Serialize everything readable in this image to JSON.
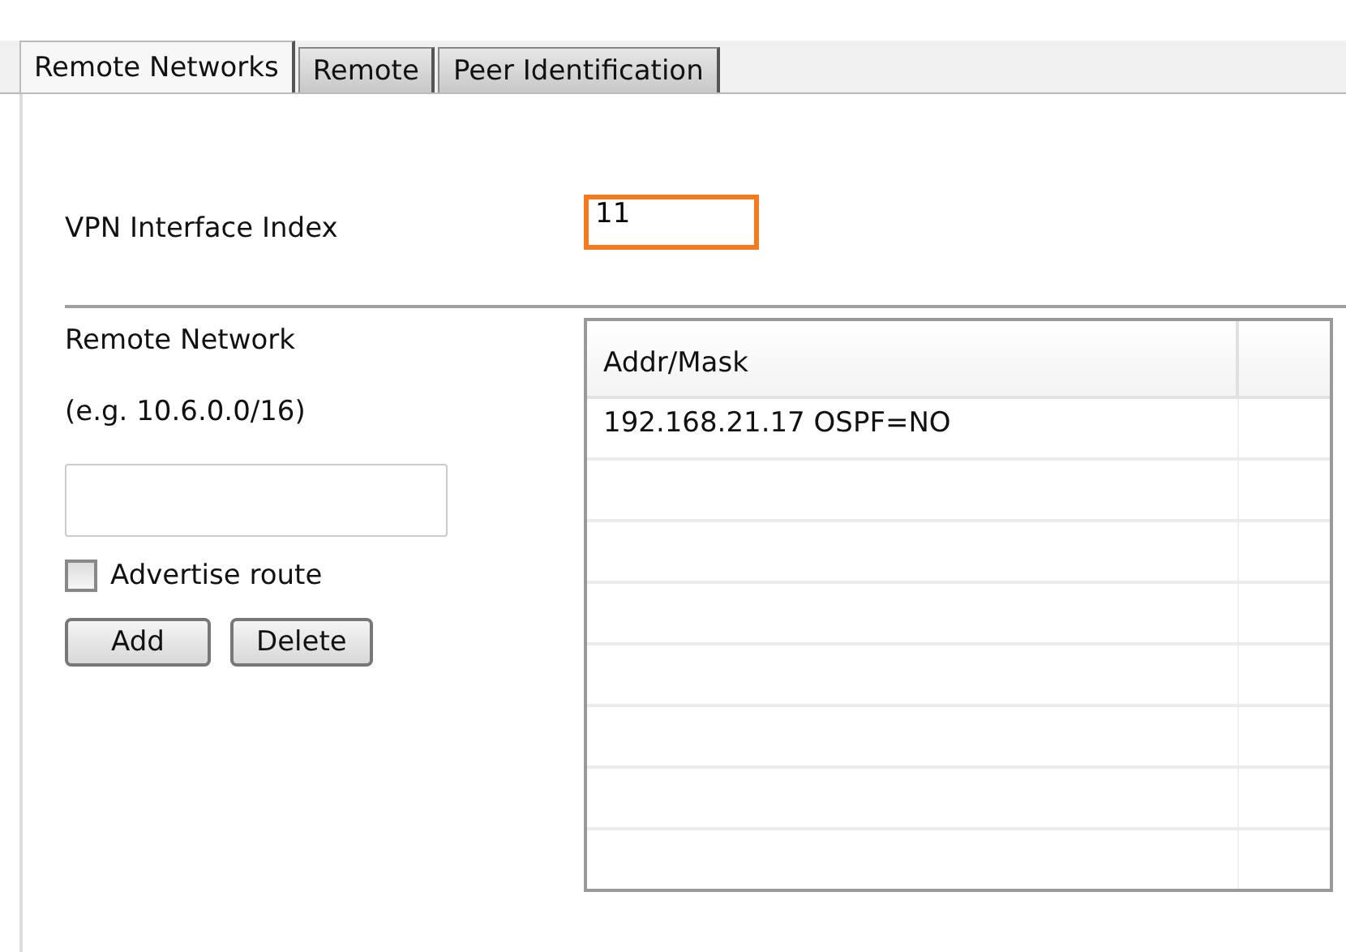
{
  "tabs": [
    {
      "label": "Remote Networks",
      "selected": true
    },
    {
      "label": "Remote",
      "selected": false
    },
    {
      "label": "Peer Identification",
      "selected": false
    }
  ],
  "vpn_interface_index": {
    "label": "VPN Interface Index",
    "value": "11",
    "focused": true
  },
  "remote_network": {
    "label": "Remote Network",
    "hint": "(e.g. 10.6.0.0/16)"
  },
  "advertise_route": {
    "label": "Advertise route",
    "checked": false
  },
  "buttons": [
    "Add",
    "Delete"
  ],
  "table": {
    "columns": [
      "Addr/Mask"
    ],
    "rows": [
      [
        "192.168.21.17 OSPF=NO"
      ]
    ]
  }
}
